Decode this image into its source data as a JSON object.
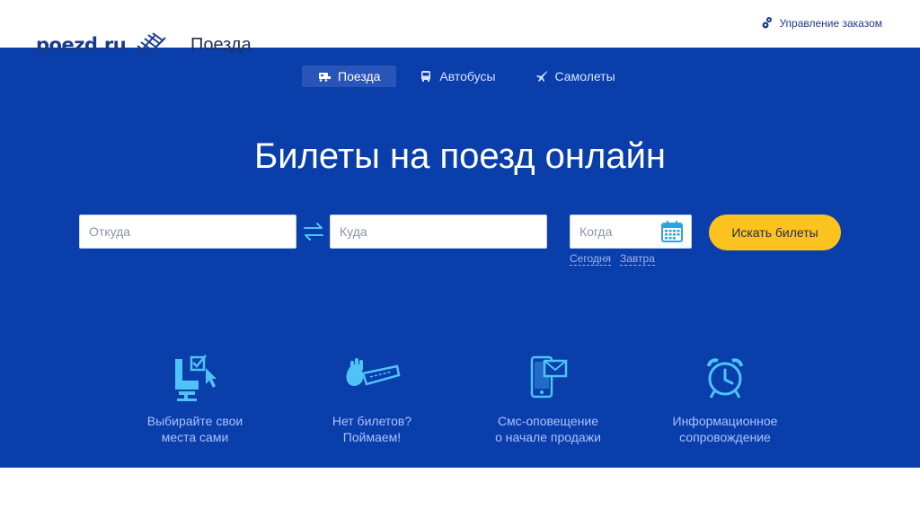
{
  "header": {
    "logo": "poezd.ru",
    "section": "Поезда",
    "manage_order": "Управление заказом"
  },
  "tabs": [
    {
      "label": "Поезда",
      "icon": "train-icon",
      "active": true
    },
    {
      "label": "Автобусы",
      "icon": "bus-icon",
      "active": false
    },
    {
      "label": "Самолеты",
      "icon": "plane-icon",
      "active": false
    }
  ],
  "headline": "Билеты на поезд онлайн",
  "search": {
    "from_placeholder": "Откуда",
    "from_value": "",
    "to_placeholder": "Куда",
    "to_value": "",
    "date_placeholder": "Когда",
    "date_value": "",
    "today": "Сегодня",
    "tomorrow": "Завтра",
    "button": "Искать билеты"
  },
  "features": [
    {
      "text": "Выбирайте свои\nместа сами",
      "icon": "seat-select-icon"
    },
    {
      "text": "Нет билетов?\nПоймаем!",
      "icon": "catch-ticket-icon"
    },
    {
      "text": "Смс-оповещение\nо начале продажи",
      "icon": "phone-sms-icon"
    },
    {
      "text": "Информационное\nсопровождение",
      "icon": "alarm-clock-icon"
    }
  ],
  "colors": {
    "hero": "#0a3eab",
    "accent": "#fcc21d",
    "icon": "#4fc3f7"
  }
}
